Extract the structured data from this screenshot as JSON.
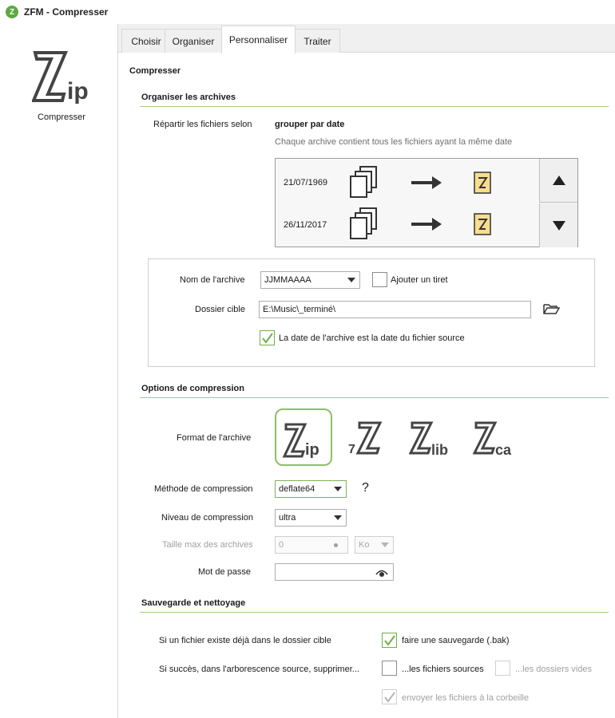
{
  "window": {
    "title": "ZFM - Compresser"
  },
  "sidebar": {
    "label": "Compresser",
    "logo_icon": "zip-logo-icon"
  },
  "tabs": [
    {
      "label": "Choisir"
    },
    {
      "label": "Organiser"
    },
    {
      "label": "Personnaliser"
    },
    {
      "label": "Traiter"
    }
  ],
  "page": {
    "title": "Compresser"
  },
  "organize": {
    "title": "Organiser les archives",
    "distribute_label": "Répartir les fichiers selon",
    "mode": "grouper par date",
    "mode_hint": "Chaque archive contient tous les fichiers ayant la même date",
    "preview_rows": [
      {
        "date": "21/07/1969"
      },
      {
        "date": "26/11/2017"
      }
    ],
    "archive_name_label": "Nom de l'archive",
    "archive_name_value": "JJMMAAAA",
    "add_dash_label": "Ajouter un tiret",
    "add_dash_checked": false,
    "target_folder_label": "Dossier cible",
    "target_folder_value": "E:\\Music\\_terminé\\",
    "date_source_label": "La date de l'archive est la date du fichier source",
    "date_source_checked": true
  },
  "compression": {
    "title": "Options de compression",
    "format_label": "Format de l'archive",
    "formats": [
      {
        "name": "zip",
        "main": "Z",
        "suffix": "ip",
        "prefix": ""
      },
      {
        "name": "7z",
        "main": "Z",
        "suffix": "",
        "prefix": "7"
      },
      {
        "name": "zlib",
        "main": "Z",
        "suffix": "lib",
        "prefix": ""
      },
      {
        "name": "zca",
        "main": "Z",
        "suffix": "ca",
        "prefix": ""
      }
    ],
    "selected_format": "zip",
    "method_label": "Méthode de compression",
    "method_value": "deflate64",
    "help_glyph": "?",
    "level_label": "Niveau de compression",
    "level_value": "ultra",
    "max_size_label": "Taille max des archives",
    "max_size_value": "0",
    "max_size_unit": "Ko",
    "password_label": "Mot de passe",
    "password_value": ""
  },
  "backup": {
    "title": "Sauvegarde et nettoyage",
    "exists_label": "Si un fichier existe déjà dans le dossier cible",
    "make_backup_label": "faire une sauvegarde (.bak)",
    "make_backup_checked": true,
    "success_label": "Si succès, dans l'arborescence source, supprimer...",
    "delete_sources_label": "...les fichiers sources",
    "delete_sources_checked": false,
    "delete_empty_dirs_label": "...les dossiers vides",
    "delete_empty_dirs_checked": false,
    "recycle_label": "envoyer les fichiers à la corbeille",
    "recycle_checked": true
  },
  "colors": {
    "accent_green": "#8cc067",
    "section_line": "#9fcf7f",
    "archive_icon_fill": "#f7dd8f"
  }
}
